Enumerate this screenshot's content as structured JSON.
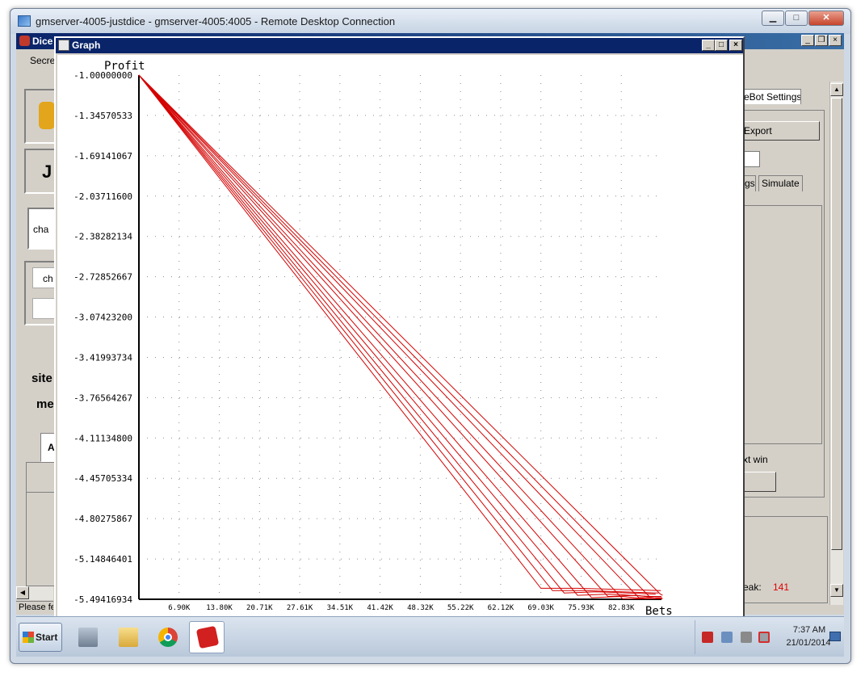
{
  "rdp": {
    "title": "gmserver-4005-justdice - gmserver-4005:4005 - Remote Desktop Connection",
    "min_label": "▁",
    "max_label": "□",
    "close_label": "✕"
  },
  "background_app": {
    "title": "Dice",
    "menu_text": "Secre",
    "tab_label": "eBot Settings",
    "export_label": "Export",
    "tab_settings_label": "gs",
    "tab_simulate_label": "Simulate",
    "next_win_label": "xt win",
    "streak_label": "eak:",
    "streak_value": "141",
    "left_labels": [
      "cha",
      "ch",
      "J",
      "site",
      "me",
      "A"
    ],
    "status_text": "Please fe"
  },
  "graph_window": {
    "title": "Graph",
    "min_label": "_",
    "max_label": "□",
    "close_label": "×"
  },
  "taskbar": {
    "start_label": "Start",
    "time": "7:37 AM",
    "date": "21/01/2014"
  },
  "chart_data": {
    "type": "line",
    "xlabel": "Bets",
    "ylabel": "Profit",
    "ylim": [
      -5.49416934,
      -1.0
    ],
    "y_ticks": [
      "-1.00000000",
      "-1.34570533",
      "-1.69141067",
      "-2.03711600",
      "-2.38282134",
      "-2.72852667",
      "-3.07423200",
      "-3.41993734",
      "-3.76564267",
      "-4.11134800",
      "-4.45705334",
      "-4.80275867",
      "-5.14846401",
      "-5.49416934"
    ],
    "x_ticks": [
      "6.90K",
      "13.80K",
      "20.71K",
      "27.61K",
      "34.51K",
      "41.42K",
      "48.32K",
      "55.22K",
      "62.12K",
      "69.03K",
      "75.93K",
      "82.83K"
    ],
    "xlim": [
      0,
      89700
    ],
    "grid": true,
    "series_color": "#d40000",
    "series": [
      {
        "x": [
          0,
          69000,
          75200,
          89600
        ],
        "y": [
          -1.0,
          -5.4,
          -5.4,
          -5.42
        ]
      },
      {
        "x": [
          0,
          71000,
          76500,
          89200
        ],
        "y": [
          -1.0,
          -5.42,
          -5.42,
          -5.44
        ]
      },
      {
        "x": [
          0,
          73000,
          78500,
          88700
        ],
        "y": [
          -1.0,
          -5.44,
          -5.43,
          -5.45
        ]
      },
      {
        "x": [
          0,
          75300,
          80800,
          87800
        ],
        "y": [
          -1.0,
          -5.46,
          -5.45,
          -5.47
        ]
      },
      {
        "x": [
          0,
          77700,
          83000,
          86900
        ],
        "y": [
          -1.0,
          -5.48,
          -5.47,
          -5.49
        ]
      },
      {
        "x": [
          0,
          80500,
          85400,
          89900
        ],
        "y": [
          -1.0,
          -5.47,
          -5.46,
          -5.49
        ]
      },
      {
        "x": [
          0,
          83000,
          89900
        ],
        "y": [
          -1.0,
          -5.49,
          -5.49
        ]
      },
      {
        "x": [
          0,
          85800,
          89800
        ],
        "y": [
          -1.0,
          -5.48,
          -5.48
        ]
      },
      {
        "x": [
          0,
          87600,
          89700
        ],
        "y": [
          -1.0,
          -5.47,
          -5.47
        ]
      },
      {
        "x": [
          0,
          89500,
          89900
        ],
        "y": [
          -1.0,
          -5.45,
          -5.46
        ]
      }
    ]
  }
}
